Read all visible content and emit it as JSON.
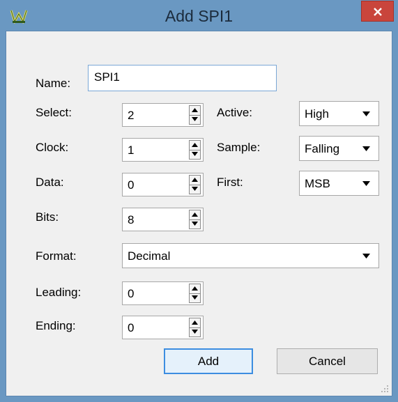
{
  "window": {
    "title": "Add SPI1",
    "app_icon": "app-logo-icon",
    "close_icon": "close-icon"
  },
  "form": {
    "name": {
      "label": "Name:",
      "value": "SPI1"
    },
    "select": {
      "label": "Select:",
      "value": "2"
    },
    "clock": {
      "label": "Clock:",
      "value": "1"
    },
    "data": {
      "label": "Data:",
      "value": "0"
    },
    "bits": {
      "label": "Bits:",
      "value": "8"
    },
    "format": {
      "label": "Format:",
      "value": "Decimal"
    },
    "leading": {
      "label": "Leading:",
      "value": "0"
    },
    "ending": {
      "label": "Ending:",
      "value": "0"
    },
    "active": {
      "label": "Active:",
      "value": "High"
    },
    "sample": {
      "label": "Sample:",
      "value": "Falling"
    },
    "first": {
      "label": "First:",
      "value": "MSB"
    }
  },
  "buttons": {
    "add": "Add",
    "cancel": "Cancel"
  },
  "colors": {
    "window_frame": "#6a98c2",
    "close_button": "#c9453c",
    "client_bg": "#f0f0f0",
    "default_button_border": "#3c8de0"
  }
}
